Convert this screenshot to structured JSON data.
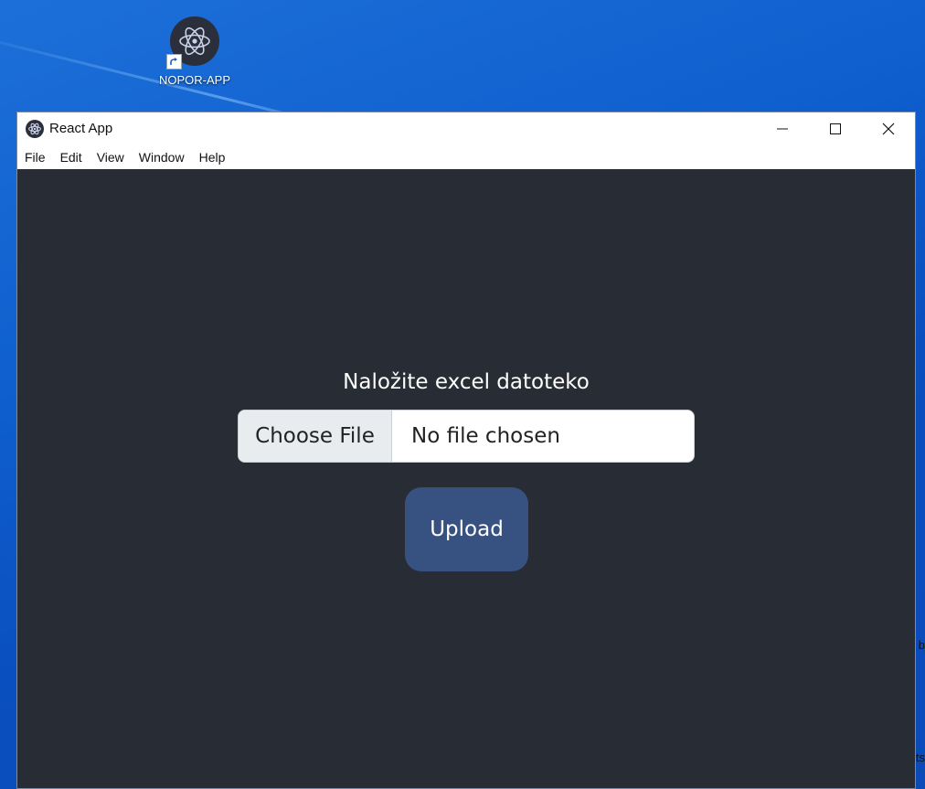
{
  "desktop": {
    "icon_label": "NOPOR-APP",
    "edge_text_1": "b",
    "edge_text_2": "ts"
  },
  "window": {
    "title": "React App",
    "icon": "electron-atom-icon",
    "controls": [
      "minimize-icon",
      "maximize-icon",
      "close-icon"
    ]
  },
  "menu": {
    "file": "File",
    "edit": "Edit",
    "view": "View",
    "window": "Window",
    "help": "Help"
  },
  "main": {
    "heading": "Naložite excel datoteko",
    "choose_file": "Choose File",
    "file_status": "No file chosen",
    "upload": "Upload"
  },
  "colors": {
    "content_bg": "#282c35",
    "upload_button": "#375180",
    "desktop_bg": "#0f5fcf"
  }
}
